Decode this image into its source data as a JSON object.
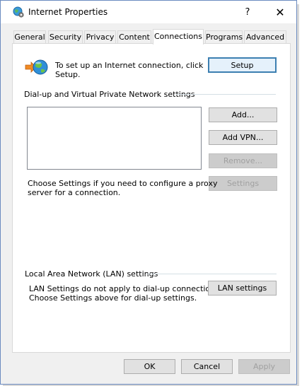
{
  "window": {
    "title": "Internet Properties",
    "help_label": "?",
    "close_label": "✕"
  },
  "tabs": [
    {
      "label": "General"
    },
    {
      "label": "Security"
    },
    {
      "label": "Privacy"
    },
    {
      "label": "Content"
    },
    {
      "label": "Connections",
      "active": true
    },
    {
      "label": "Programs"
    },
    {
      "label": "Advanced"
    }
  ],
  "setup": {
    "text_line1": "To set up an Internet connection, click",
    "text_line2": "Setup.",
    "button_label": "Setup"
  },
  "dialup": {
    "group_label": "Dial-up and Virtual Private Network settings",
    "add_label": "Add...",
    "add_vpn_label": "Add VPN...",
    "remove_label": "Remove...",
    "settings_label": "Settings",
    "hint_line1": "Choose Settings if you need to configure a proxy",
    "hint_line2": "server for a connection."
  },
  "lan": {
    "group_label": "Local Area Network (LAN) settings",
    "text_line1": "LAN Settings do not apply to dial-up connections.",
    "text_line2": "Choose Settings above for dial-up settings.",
    "button_label": "LAN settings"
  },
  "footer": {
    "ok_label": "OK",
    "cancel_label": "Cancel",
    "apply_label": "Apply"
  },
  "icons": {
    "title": "globe-settings-icon",
    "setup": "globe-network-icon",
    "close": "close-icon"
  }
}
